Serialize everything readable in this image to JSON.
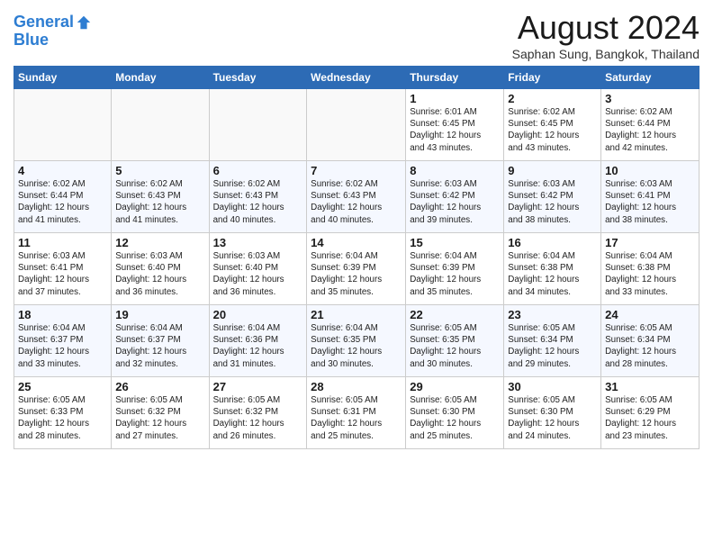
{
  "header": {
    "logo_line1": "General",
    "logo_line2": "Blue",
    "month_title": "August 2024",
    "subtitle": "Saphan Sung, Bangkok, Thailand"
  },
  "weekdays": [
    "Sunday",
    "Monday",
    "Tuesday",
    "Wednesday",
    "Thursday",
    "Friday",
    "Saturday"
  ],
  "weeks": [
    [
      {
        "day": "",
        "info": ""
      },
      {
        "day": "",
        "info": ""
      },
      {
        "day": "",
        "info": ""
      },
      {
        "day": "",
        "info": ""
      },
      {
        "day": "1",
        "info": "Sunrise: 6:01 AM\nSunset: 6:45 PM\nDaylight: 12 hours\nand 43 minutes."
      },
      {
        "day": "2",
        "info": "Sunrise: 6:02 AM\nSunset: 6:45 PM\nDaylight: 12 hours\nand 43 minutes."
      },
      {
        "day": "3",
        "info": "Sunrise: 6:02 AM\nSunset: 6:44 PM\nDaylight: 12 hours\nand 42 minutes."
      }
    ],
    [
      {
        "day": "4",
        "info": "Sunrise: 6:02 AM\nSunset: 6:44 PM\nDaylight: 12 hours\nand 41 minutes."
      },
      {
        "day": "5",
        "info": "Sunrise: 6:02 AM\nSunset: 6:43 PM\nDaylight: 12 hours\nand 41 minutes."
      },
      {
        "day": "6",
        "info": "Sunrise: 6:02 AM\nSunset: 6:43 PM\nDaylight: 12 hours\nand 40 minutes."
      },
      {
        "day": "7",
        "info": "Sunrise: 6:02 AM\nSunset: 6:43 PM\nDaylight: 12 hours\nand 40 minutes."
      },
      {
        "day": "8",
        "info": "Sunrise: 6:03 AM\nSunset: 6:42 PM\nDaylight: 12 hours\nand 39 minutes."
      },
      {
        "day": "9",
        "info": "Sunrise: 6:03 AM\nSunset: 6:42 PM\nDaylight: 12 hours\nand 38 minutes."
      },
      {
        "day": "10",
        "info": "Sunrise: 6:03 AM\nSunset: 6:41 PM\nDaylight: 12 hours\nand 38 minutes."
      }
    ],
    [
      {
        "day": "11",
        "info": "Sunrise: 6:03 AM\nSunset: 6:41 PM\nDaylight: 12 hours\nand 37 minutes."
      },
      {
        "day": "12",
        "info": "Sunrise: 6:03 AM\nSunset: 6:40 PM\nDaylight: 12 hours\nand 36 minutes."
      },
      {
        "day": "13",
        "info": "Sunrise: 6:03 AM\nSunset: 6:40 PM\nDaylight: 12 hours\nand 36 minutes."
      },
      {
        "day": "14",
        "info": "Sunrise: 6:04 AM\nSunset: 6:39 PM\nDaylight: 12 hours\nand 35 minutes."
      },
      {
        "day": "15",
        "info": "Sunrise: 6:04 AM\nSunset: 6:39 PM\nDaylight: 12 hours\nand 35 minutes."
      },
      {
        "day": "16",
        "info": "Sunrise: 6:04 AM\nSunset: 6:38 PM\nDaylight: 12 hours\nand 34 minutes."
      },
      {
        "day": "17",
        "info": "Sunrise: 6:04 AM\nSunset: 6:38 PM\nDaylight: 12 hours\nand 33 minutes."
      }
    ],
    [
      {
        "day": "18",
        "info": "Sunrise: 6:04 AM\nSunset: 6:37 PM\nDaylight: 12 hours\nand 33 minutes."
      },
      {
        "day": "19",
        "info": "Sunrise: 6:04 AM\nSunset: 6:37 PM\nDaylight: 12 hours\nand 32 minutes."
      },
      {
        "day": "20",
        "info": "Sunrise: 6:04 AM\nSunset: 6:36 PM\nDaylight: 12 hours\nand 31 minutes."
      },
      {
        "day": "21",
        "info": "Sunrise: 6:04 AM\nSunset: 6:35 PM\nDaylight: 12 hours\nand 30 minutes."
      },
      {
        "day": "22",
        "info": "Sunrise: 6:05 AM\nSunset: 6:35 PM\nDaylight: 12 hours\nand 30 minutes."
      },
      {
        "day": "23",
        "info": "Sunrise: 6:05 AM\nSunset: 6:34 PM\nDaylight: 12 hours\nand 29 minutes."
      },
      {
        "day": "24",
        "info": "Sunrise: 6:05 AM\nSunset: 6:34 PM\nDaylight: 12 hours\nand 28 minutes."
      }
    ],
    [
      {
        "day": "25",
        "info": "Sunrise: 6:05 AM\nSunset: 6:33 PM\nDaylight: 12 hours\nand 28 minutes."
      },
      {
        "day": "26",
        "info": "Sunrise: 6:05 AM\nSunset: 6:32 PM\nDaylight: 12 hours\nand 27 minutes."
      },
      {
        "day": "27",
        "info": "Sunrise: 6:05 AM\nSunset: 6:32 PM\nDaylight: 12 hours\nand 26 minutes."
      },
      {
        "day": "28",
        "info": "Sunrise: 6:05 AM\nSunset: 6:31 PM\nDaylight: 12 hours\nand 25 minutes."
      },
      {
        "day": "29",
        "info": "Sunrise: 6:05 AM\nSunset: 6:30 PM\nDaylight: 12 hours\nand 25 minutes."
      },
      {
        "day": "30",
        "info": "Sunrise: 6:05 AM\nSunset: 6:30 PM\nDaylight: 12 hours\nand 24 minutes."
      },
      {
        "day": "31",
        "info": "Sunrise: 6:05 AM\nSunset: 6:29 PM\nDaylight: 12 hours\nand 23 minutes."
      }
    ]
  ]
}
